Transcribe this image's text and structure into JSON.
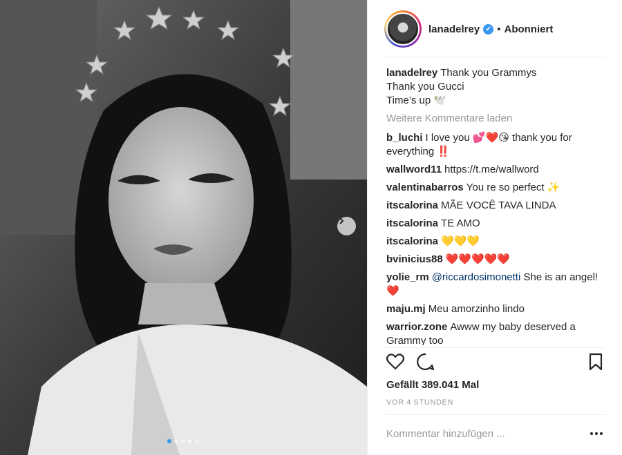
{
  "post": {
    "carousel": {
      "count": 5,
      "active_index": 0
    }
  },
  "header": {
    "username": "lanadelrey",
    "verified_mark": "✔",
    "separator": "•",
    "follow_status": "Abonniert"
  },
  "caption": {
    "user": "lanadelrey",
    "lines": [
      "Thank you Grammys",
      "Thank you Gucci",
      "Time’s up 🕊️"
    ]
  },
  "load_more": "Weitere Kommentare laden",
  "comments": [
    {
      "user": "b_luchi",
      "text": "I love you 💕❤️😘 thank you for everything ‼️"
    },
    {
      "user": "wallword11",
      "text": "https://t.me/wallword"
    },
    {
      "user": "valentinabarros",
      "text": "You re so perfect ✨"
    },
    {
      "user": "itscalorina",
      "text": "MÃE VOCÊ TAVA LINDA"
    },
    {
      "user": "itscalorina",
      "text": "TE AMO"
    },
    {
      "user": "itscalorina",
      "text": "💛💛💛"
    },
    {
      "user": "bvinicius88",
      "text": "❤️❤️❤️❤️❤️"
    },
    {
      "user": "yolie_rm",
      "mention": "@riccardosimonetti",
      "text": "She is an angel! ❤️"
    },
    {
      "user": "maju.mj",
      "text": "Meu amorzinho lindo"
    },
    {
      "user": "warrior.zone",
      "text": "Awww my baby deserved a Grammy too"
    }
  ],
  "likes": "Gefällt 389.041 Mal",
  "timestamp": "VOR 4 STUNDEN",
  "add_comment_placeholder": "Kommentar hinzufügen ...",
  "icons": {
    "like": "heart-icon",
    "comment": "comment-icon",
    "save": "bookmark-icon",
    "next": "chevron-right-icon",
    "more": "more-options-icon"
  },
  "colors": {
    "verified": "#3897f0",
    "link": "#003569",
    "muted": "#999999"
  }
}
